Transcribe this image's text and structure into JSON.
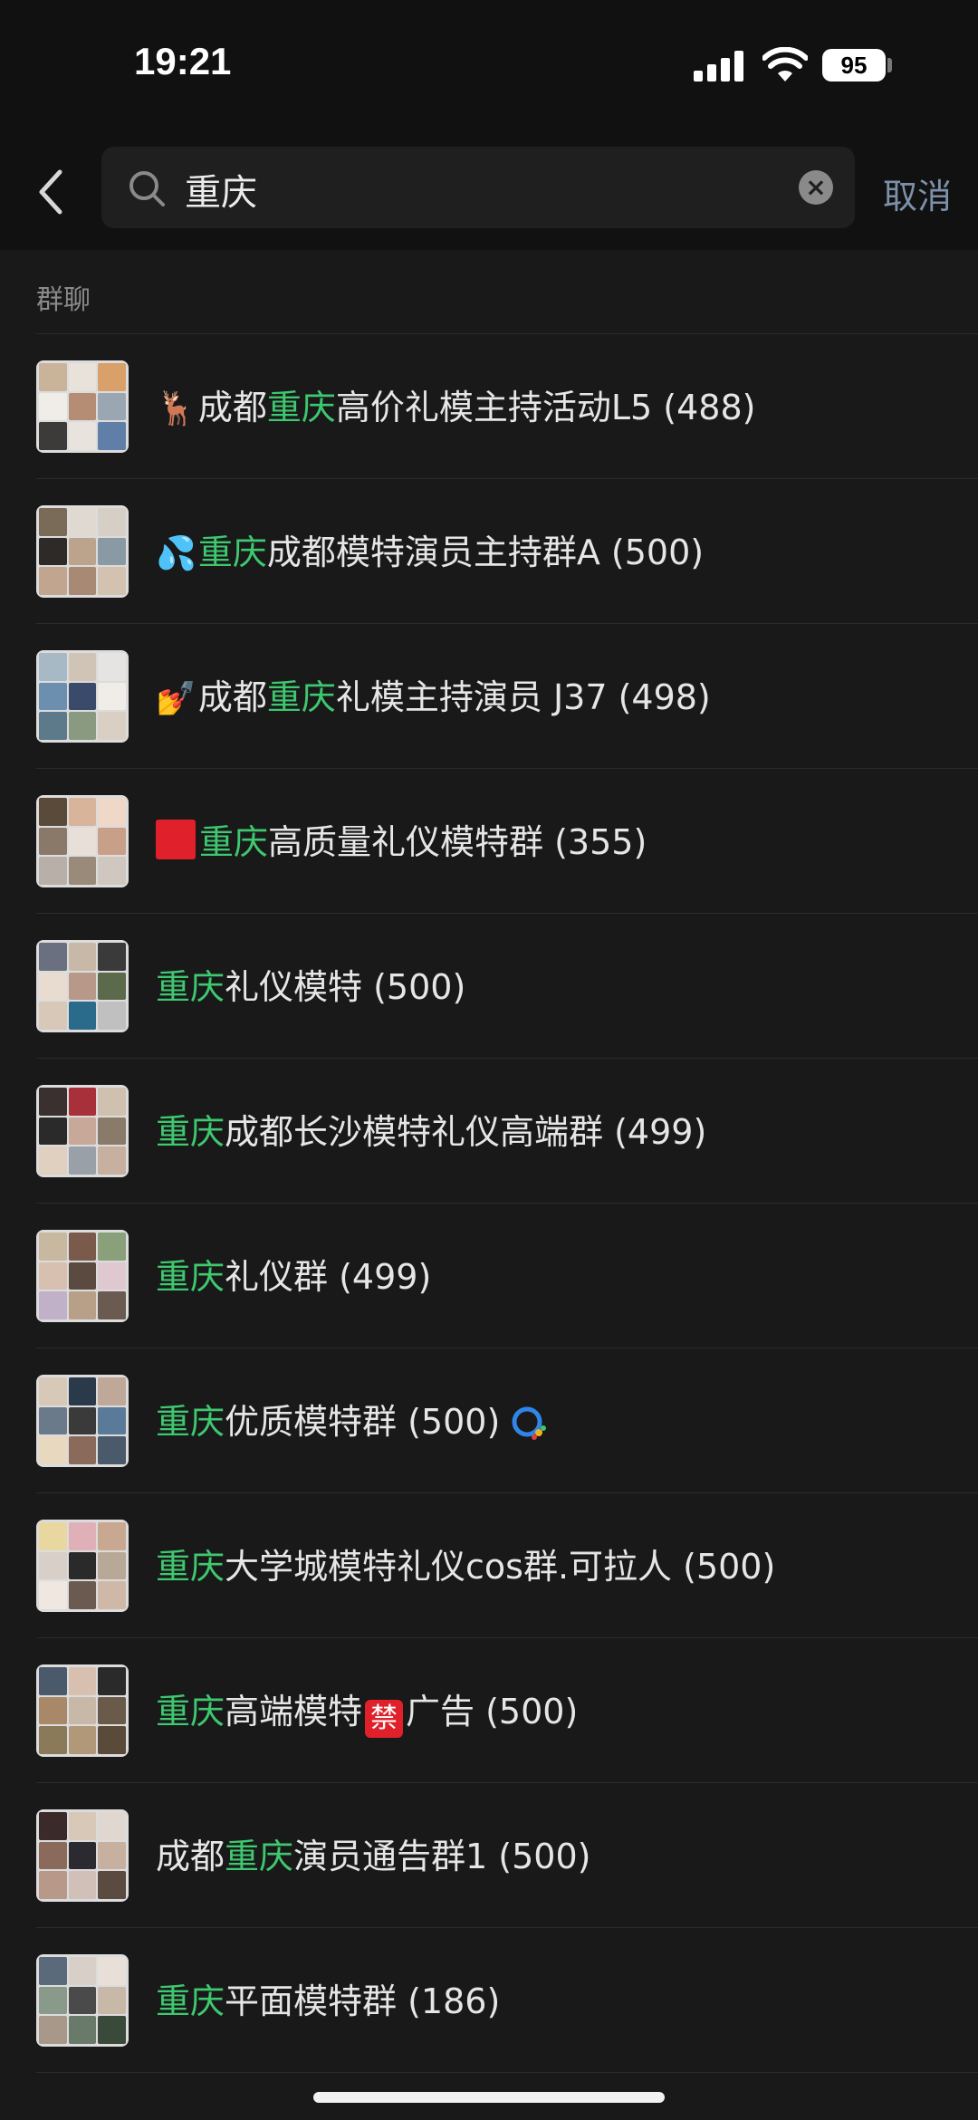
{
  "status_bar": {
    "time": "19:21",
    "battery": "95"
  },
  "search": {
    "query": "重庆",
    "cancel_label": "取消"
  },
  "section": {
    "title": "群聊"
  },
  "results": [
    {
      "prefix_emoji": "🦌",
      "before": "成都",
      "highlight": "重庆",
      "after": "高价礼模主持活动L5 (488)"
    },
    {
      "prefix_emoji": "💦",
      "before": "",
      "highlight": "重庆",
      "after": "成都模特演员主持群A (500)"
    },
    {
      "prefix_emoji": "💅",
      "before": "成都",
      "highlight": "重庆",
      "after": "礼模主持演员 J37 (498)"
    },
    {
      "prefix_emoji": "",
      "before": "",
      "highlight": "重庆",
      "after": "高质量礼仪模特群 (355)"
    },
    {
      "prefix_emoji": "",
      "before": "",
      "highlight": "重庆",
      "after": "礼仪模特 (500)"
    },
    {
      "prefix_emoji": "",
      "before": "",
      "highlight": "重庆",
      "after": "成都长沙模特礼仪高端群 (499)"
    },
    {
      "prefix_emoji": "",
      "before": "",
      "highlight": "重庆",
      "after": "礼仪群 (499)"
    },
    {
      "prefix_emoji": "",
      "before": "",
      "highlight": "重庆",
      "after": "优质模特群 (500)"
    },
    {
      "prefix_emoji": "",
      "before": "",
      "highlight": "重庆",
      "after": "大学城模特礼仪cos群.可拉人 (500)"
    },
    {
      "prefix_emoji": "",
      "before": "",
      "highlight": "重庆",
      "after_a": "高端模特",
      "ban_text": "禁",
      "after": "广告 (500)"
    },
    {
      "prefix_emoji": "",
      "before": "成都",
      "highlight": "重庆",
      "after": "演员通告群1 (500)"
    },
    {
      "prefix_emoji": "",
      "before": "",
      "highlight": "重庆",
      "after": "平面模特群 (186)"
    }
  ],
  "icons": {
    "back": "chevron-left-icon",
    "search": "search-icon",
    "clear": "clear-icon",
    "red_square": "red-square-icon",
    "enterprise": "enterprise-wechat-icon"
  },
  "colors": {
    "background": "#191919",
    "header": "#111111",
    "highlight": "#3ec86f",
    "cancel": "#7d90a9"
  }
}
